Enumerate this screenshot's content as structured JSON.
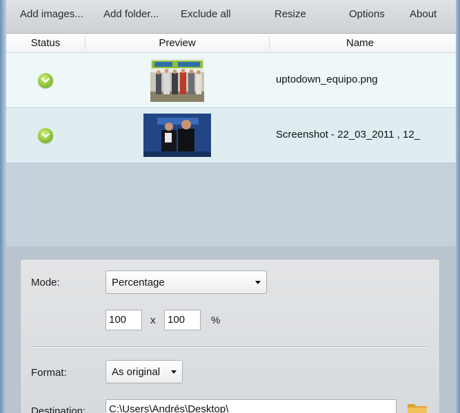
{
  "toolbar": {
    "add_images": "Add images...",
    "add_folder": "Add folder...",
    "exclude_all": "Exclude all",
    "resize": "Resize",
    "options": "Options",
    "about": "About"
  },
  "grid": {
    "columns": [
      "Status",
      "Preview",
      "Name"
    ],
    "rows": [
      {
        "status": "check-icon",
        "name": "uptodown_equipo.png"
      },
      {
        "status": "check-icon",
        "name": "Screenshot - 22_03_2011 , 12_"
      }
    ]
  },
  "settings": {
    "mode_label": "Mode:",
    "mode_value": "Percentage",
    "width_value": "100",
    "x_label": "x",
    "height_value": "100",
    "percent_label": "%",
    "format_label": "Format:",
    "format_value": "As original",
    "destination_label": "Destination:",
    "destination_value": "C:\\Users\\Andrés\\Desktop\\"
  },
  "colors": {
    "status_ok": "#8fc43b",
    "row_light": "#eef8f9",
    "row_alt": "#dfedf0",
    "folder": "#e9b64a"
  }
}
